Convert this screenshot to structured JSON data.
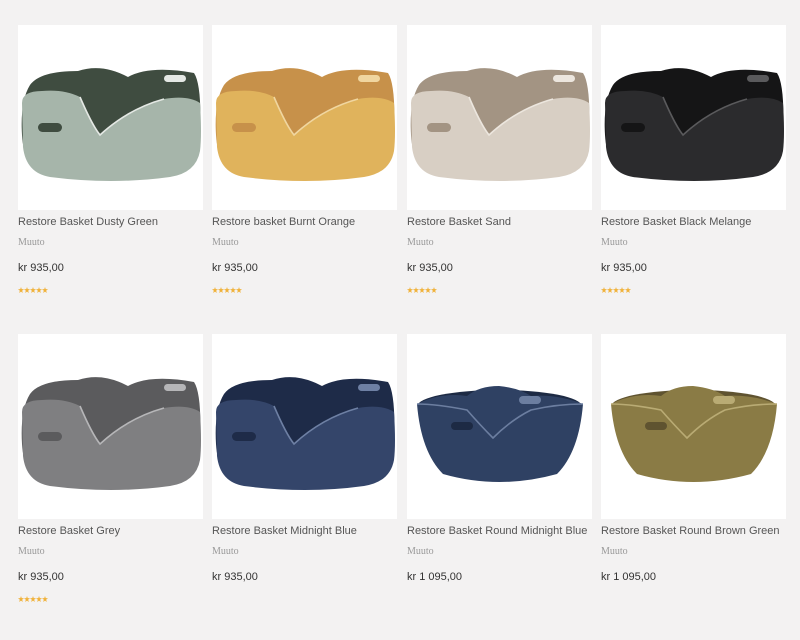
{
  "products": [
    {
      "title": "Restore Basket Dusty Green",
      "brand": "Muuto",
      "price": "kr 935,00",
      "rating": 5,
      "image": "basket-rect-dusty-green",
      "outer": "#a6b5aa",
      "inner": "#3f4c40",
      "rim": "#e4e8e4"
    },
    {
      "title": "Restore basket Burnt Orange",
      "brand": "Muuto",
      "price": "kr 935,00",
      "rating": 5,
      "image": "basket-rect-burnt-orange",
      "outer": "#e0b35c",
      "inner": "#c7914a",
      "rim": "#f0d6a0"
    },
    {
      "title": "Restore Basket Sand",
      "brand": "Muuto",
      "price": "kr 935,00",
      "rating": 5,
      "image": "basket-rect-sand",
      "outer": "#d8cfc4",
      "inner": "#a39483",
      "rim": "#ece6de"
    },
    {
      "title": "Restore Basket Black Melange",
      "brand": "Muuto",
      "price": "kr 935,00",
      "rating": 5,
      "image": "basket-rect-black-melange",
      "outer": "#2b2b2d",
      "inner": "#151516",
      "rim": "#5a5a5c"
    },
    {
      "title": "Restore Basket Grey",
      "brand": "Muuto",
      "price": "kr 935,00",
      "rating": 5,
      "image": "basket-rect-grey",
      "outer": "#7f7f81",
      "inner": "#5b5b5d",
      "rim": "#b6b6b8"
    },
    {
      "title": "Restore Basket Midnight Blue",
      "brand": "Muuto",
      "price": "kr 935,00",
      "rating": 0,
      "image": "basket-rect-midnight-blue",
      "outer": "#34456a",
      "inner": "#1e2b48",
      "rim": "#6e80a4"
    },
    {
      "title": "Restore Basket Round Midnight Blue",
      "brand": "Muuto",
      "price": "kr 1 095,00",
      "rating": 0,
      "image": "basket-round-midnight-blue",
      "outer": "#2f4163",
      "inner": "#1d2a44",
      "rim": "#6c7ea0"
    },
    {
      "title": "Restore Basket Round Brown Green",
      "brand": "Muuto",
      "price": "kr 1 095,00",
      "rating": 0,
      "image": "basket-round-brown-green",
      "outer": "#8a7b45",
      "inner": "#5f5330",
      "rim": "#b9ab74"
    }
  ]
}
